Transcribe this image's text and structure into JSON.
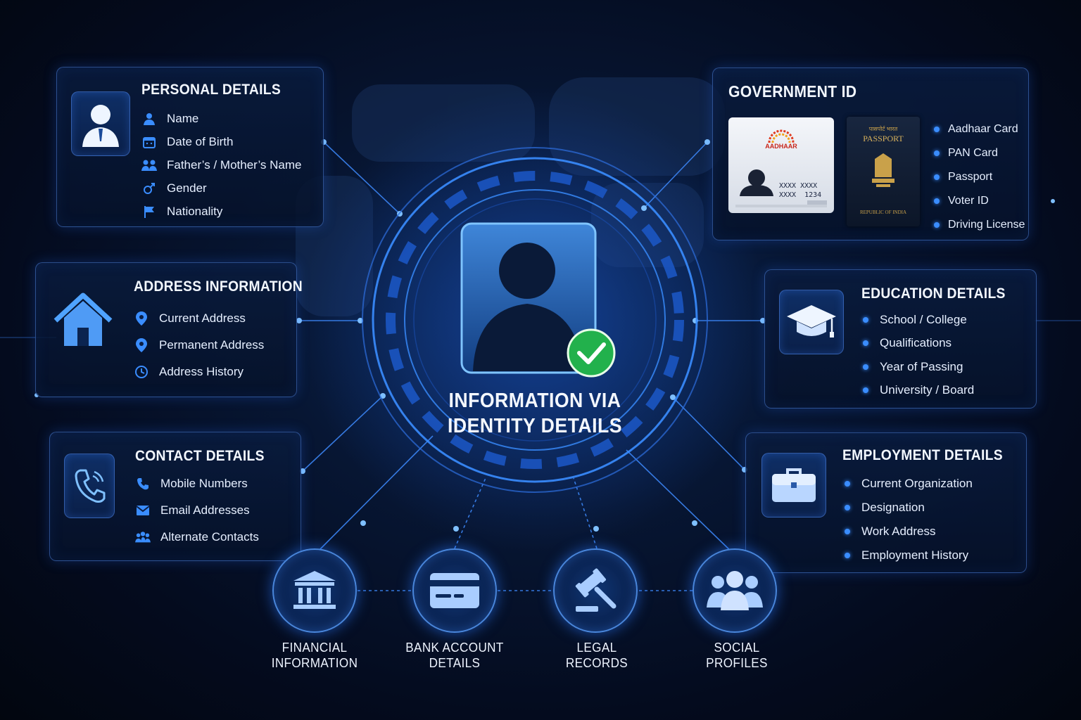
{
  "center": {
    "title_line1": "INFORMATION VIA",
    "title_line2": "IDENTITY DETAILS"
  },
  "personal": {
    "title": "PERSONAL DETAILS",
    "items": [
      {
        "label": "Name",
        "icon": "person-icon"
      },
      {
        "label": "Date of Birth",
        "icon": "calendar-icon"
      },
      {
        "label": "Father’s / Mother’s Name",
        "icon": "family-icon"
      },
      {
        "label": "Gender",
        "icon": "gender-icon"
      },
      {
        "label": "Nationality",
        "icon": "flag-icon"
      }
    ]
  },
  "address": {
    "title": "ADDRESS INFORMATION",
    "items": [
      {
        "label": "Current Address",
        "icon": "location-pin-icon"
      },
      {
        "label": "Permanent Address",
        "icon": "location-pin-icon"
      },
      {
        "label": "Address History",
        "icon": "clock-icon"
      }
    ]
  },
  "contact": {
    "title": "CONTACT DETAILS",
    "items": [
      {
        "label": "Mobile Numbers",
        "icon": "phone-icon"
      },
      {
        "label": "Email Addresses",
        "icon": "email-icon"
      },
      {
        "label": "Alternate Contacts",
        "icon": "group-icon"
      }
    ]
  },
  "government": {
    "title": "GOVERNMENT ID",
    "aadhaar_card": {
      "brand": "AADHAAR",
      "number_line1": "XXXX XXXX",
      "number_line2": "XXXX  1234"
    },
    "passport": {
      "header_hindi": "पासपोर्ट भारत",
      "title": "PASSPORT",
      "footer": "REPUBLIC OF INDIA"
    },
    "items": [
      "Aadhaar Card",
      "PAN Card",
      "Passport",
      "Voter ID",
      "Driving License"
    ]
  },
  "education": {
    "title": "EDUCATION DETAILS",
    "items": [
      "School / College",
      "Qualifications",
      "Year of Passing",
      "University / Board"
    ]
  },
  "employment": {
    "title": "EMPLOYMENT DETAILS",
    "items": [
      "Current Organization",
      "Designation",
      "Work Address",
      "Employment History"
    ]
  },
  "bottom_nodes": [
    {
      "line1": "FINANCIAL",
      "line2": "INFORMATION",
      "icon": "bank-icon"
    },
    {
      "line1": "BANK ACCOUNT",
      "line2": "DETAILS",
      "icon": "credit-card-icon"
    },
    {
      "line1": "LEGAL",
      "line2": "RECORDS",
      "icon": "gavel-icon"
    },
    {
      "line1": "SOCIAL",
      "line2": "PROFILES",
      "icon": "social-group-icon"
    }
  ],
  "colors": {
    "accent": "#3a8dff",
    "verified": "#22b14c",
    "background": "#040b1e"
  }
}
